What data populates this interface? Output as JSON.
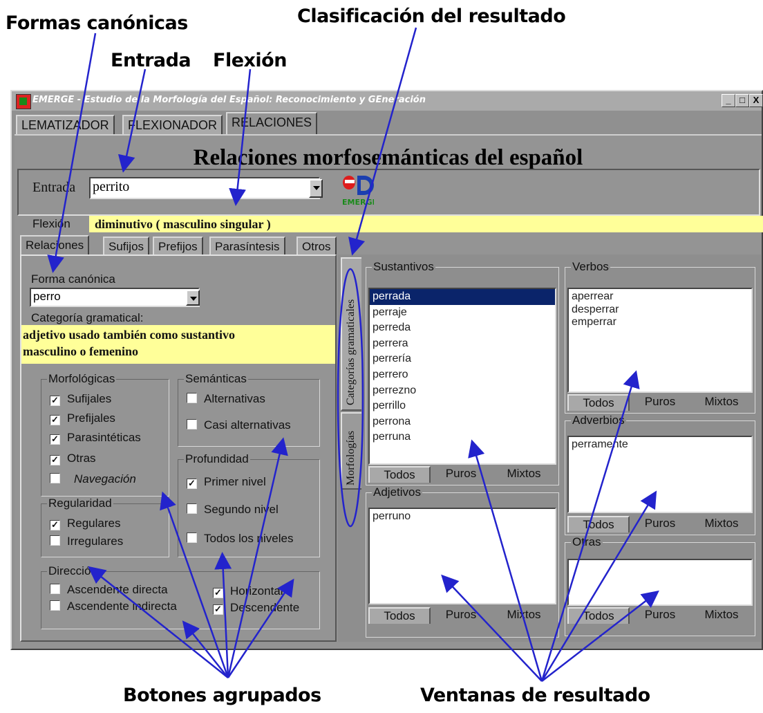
{
  "annotations": {
    "formas_canonicas": "Formas canónicas",
    "clasificacion": "Clasificación del resultado",
    "entrada": "Entrada",
    "flexion": "Flexión",
    "botones_agrupados": "Botones agrupados",
    "ventanas_resultado": "Ventanas de resultado"
  },
  "window": {
    "title": "EMERGE - Estudio de la Morfología del Español: Reconocimiento y GEneración",
    "buttons": [
      "_",
      "□",
      "X"
    ],
    "main_tabs": [
      "LEMATIZADOR",
      "FLEXIONADOR",
      "RELACIONES"
    ],
    "active_tab": "RELACIONES"
  },
  "heading": "Relaciones morfosemánticas del español",
  "entrada": {
    "label": "Entrada",
    "value": "perrito",
    "logo_text": "EMERGE"
  },
  "flexion": {
    "label": "Flexión",
    "value": "diminutivo ( masculino singular )"
  },
  "sub_tabs": [
    "Relaciones",
    "Sufijos",
    "Prefijos",
    "Parasíntesis",
    "Otros"
  ],
  "left": {
    "forma_label": "Forma canónica",
    "forma_value": "perro",
    "categoria_label": "Categoría gramatical:",
    "categoria_line1": "adjetivo usado también como sustantivo",
    "categoria_line2": "masculino o femenino",
    "morfologicas": {
      "title": "Morfológicas",
      "items": [
        "Sufijales",
        "Prefijales",
        "Parasintéticas",
        "Otras",
        "Navegación"
      ]
    },
    "semanticas": {
      "title": "Semánticas",
      "items": [
        "Alternativas",
        "Casi alternativas"
      ]
    },
    "profundidad": {
      "title": "Profundidad",
      "items": [
        "Primer nivel",
        "Segundo nivel",
        "Todos los niveles"
      ]
    },
    "regularidad": {
      "title": "Regularidad",
      "items": [
        "Regulares",
        "Irregulares"
      ]
    },
    "direccion": {
      "title": "Dirección",
      "items": [
        "Ascendente directa",
        "Ascendente indirecta",
        "Horizontal",
        "Descendente"
      ]
    }
  },
  "vertical_tabs": [
    "Categorías gramaticales",
    "Morfologías"
  ],
  "results": {
    "sustantivos": {
      "title": "Sustantivos",
      "items": [
        "perrada",
        "perraje",
        "perreda",
        "perrera",
        "perrería",
        "perrero",
        "perrezno",
        "perrillo",
        "perrona",
        "perruna"
      ],
      "selected": "perrada"
    },
    "adjetivos": {
      "title": "Adjetivos",
      "items": [
        "perruno"
      ]
    },
    "verbos": {
      "title": "Verbos",
      "items": [
        "aperrear",
        "desperrar",
        "emperrar"
      ]
    },
    "adverbios": {
      "title": "Adverbios",
      "items": [
        "perramente"
      ]
    },
    "otras": {
      "title": "Otras",
      "items": []
    },
    "filter_tabs": [
      "Todos",
      "Puros",
      "Mixtos"
    ]
  },
  "colors": {
    "window_gray": "#949494",
    "highlight_yellow": "#ffff99",
    "selection_blue": "#0a246a",
    "arrow_blue": "#2323cc"
  }
}
